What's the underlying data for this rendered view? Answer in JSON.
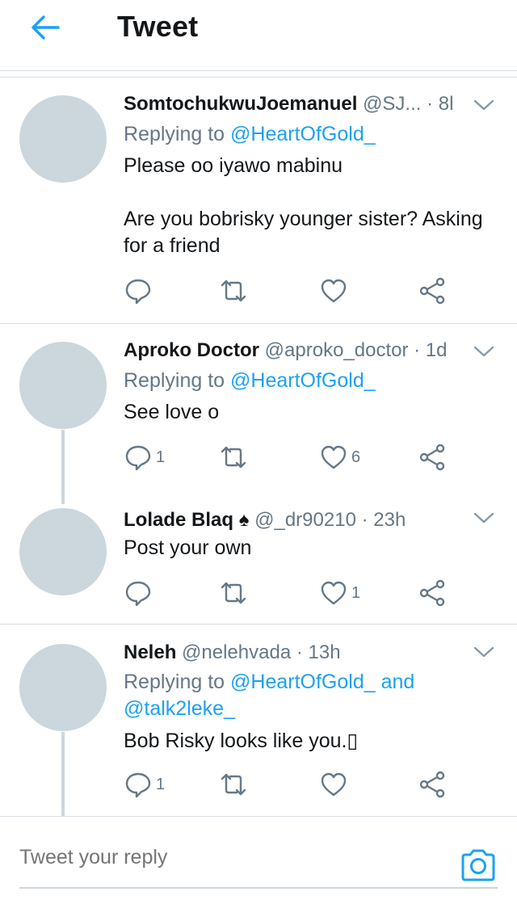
{
  "header": {
    "title": "Tweet",
    "back_icon": "arrow-left-icon",
    "accent": "#1da1f2"
  },
  "colors": {
    "text": "#14171a",
    "secondary": "#657786",
    "link": "#1da1f2",
    "avatar": "#ccd6dd",
    "divider": "#d8dee3"
  },
  "tweets": [
    {
      "name": "SomtochukwuJoemanuel",
      "handle": "@SJ...",
      "time": "8h",
      "replying_prefix": "Replying to ",
      "replying_to": "@HeartOfGold_",
      "replying_joiner": "",
      "replying_to_2": "",
      "text": "Please oo iyawo mabinu\n\nAre you bobrisky younger sister?   Asking for a friend",
      "reply_count": "",
      "retweet_count": "",
      "like_count": ""
    },
    {
      "name": "Aproko Doctor",
      "handle": "@aproko_doctor",
      "time": "1d",
      "replying_prefix": "Replying to ",
      "replying_to": "@HeartOfGold_",
      "text": "See love o",
      "reply_count": "1",
      "retweet_count": "",
      "like_count": "6"
    },
    {
      "name": "Lolade Blaq",
      "name_emoji": "♠",
      "handle": "@_dr90210",
      "time": "23h",
      "text": "Post your own",
      "reply_count": "",
      "retweet_count": "",
      "like_count": "1"
    },
    {
      "name": "Neleh",
      "handle": "@nelehvada",
      "time": "13h",
      "replying_prefix": "Replying to ",
      "replying_to": "@HeartOfGold_",
      "replying_joiner": " and",
      "replying_to_2": "@talk2leke_",
      "text": "Bob Risky looks like you.▯",
      "reply_count": "1",
      "retweet_count": "",
      "like_count": ""
    }
  ],
  "reply_bar": {
    "placeholder": "Tweet your reply",
    "camera_icon": "camera-icon"
  }
}
